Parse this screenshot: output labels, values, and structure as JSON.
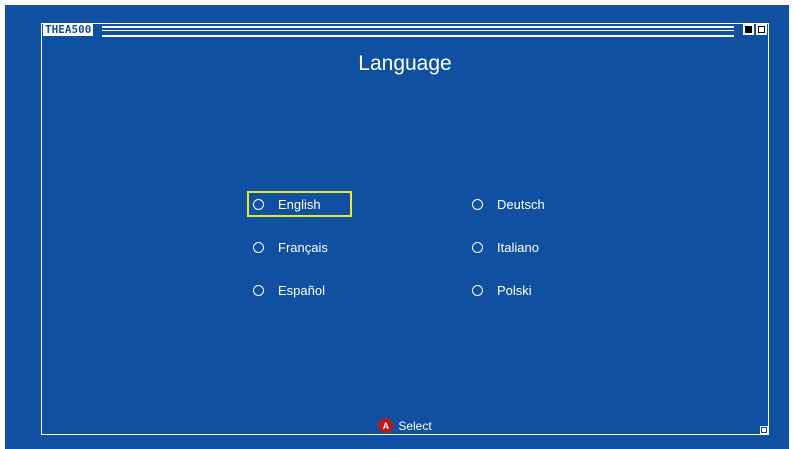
{
  "window": {
    "title": "THEA500"
  },
  "page": {
    "title": "Language"
  },
  "languages": [
    {
      "label": "English",
      "selected": false,
      "focused": true
    },
    {
      "label": "Deutsch",
      "selected": false,
      "focused": false
    },
    {
      "label": "Français",
      "selected": false,
      "focused": false
    },
    {
      "label": "Italiano",
      "selected": false,
      "focused": false
    },
    {
      "label": "Español",
      "selected": false,
      "focused": false
    },
    {
      "label": "Polski",
      "selected": false,
      "focused": false
    }
  ],
  "footer": {
    "button": "A",
    "action": "Select"
  },
  "colors": {
    "background": "#1050a0",
    "focus": "#e8e830",
    "button_a": "#c01818"
  }
}
